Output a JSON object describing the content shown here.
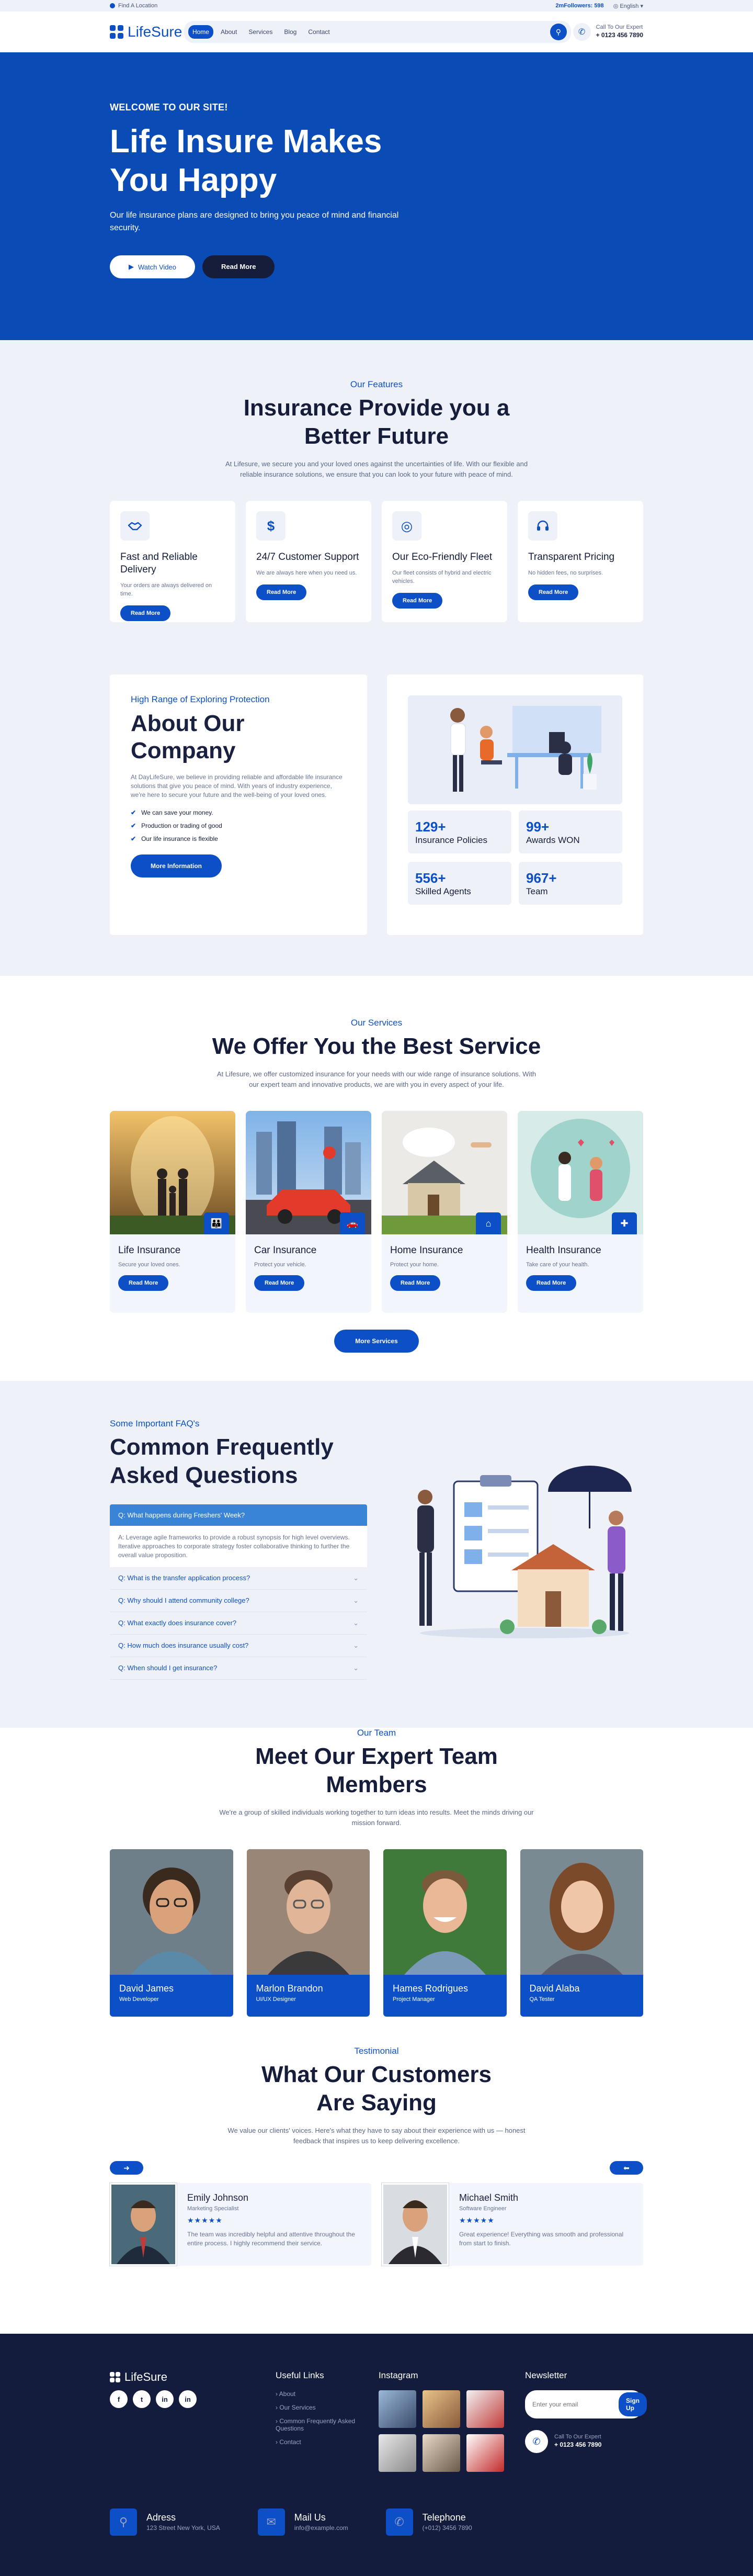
{
  "topbar": {
    "location": "Find A Location",
    "followers": "2mFollowers: 598",
    "language": "English"
  },
  "header": {
    "brand": "LifeSure",
    "nav": [
      "Home",
      "About",
      "Services",
      "Blog",
      "Contact"
    ],
    "call_label": "Call To Our Expert",
    "call_number": "+ 0123 456 7890"
  },
  "hero": {
    "welcome": "WELCOME TO OUR SITE!",
    "title": "Life Insure Makes You Happy",
    "text": "Our life insurance plans are designed to bring you peace of mind and financial security.",
    "watch_label": "Watch Video",
    "read_label": "Read More"
  },
  "features": {
    "eyebrow": "Our Features",
    "title": "Insurance Provide you a Better Future",
    "desc": "At Lifesure, we secure you and your loved ones against the uncertainties of life. With our flexible and reliable insurance solutions, we ensure that you can look to your future with peace of mind.",
    "cards": [
      {
        "title": "Fast and Reliable Delivery",
        "text": "Your orders are always delivered on time.",
        "icon": "handshake-icon",
        "btn": "Read More"
      },
      {
        "title": "24/7 Customer Support",
        "text": "We are always here when you need us.",
        "icon": "dollar-icon",
        "btn": "Read More"
      },
      {
        "title": "Our Eco-Friendly Fleet",
        "text": "Our fleet consists of hybrid and electric vehicles.",
        "icon": "target-icon",
        "btn": "Read More"
      },
      {
        "title": "Transparent Pricing",
        "text": "No hidden fees, no surprises.",
        "icon": "headset-icon",
        "btn": "Read More"
      }
    ]
  },
  "about": {
    "eyebrow": "High Range of Exploring Protection",
    "title": "About Our Company",
    "text": "At DayLifeSure, we believe in providing reliable and affordable life insurance solutions that give you peace of mind. With years of industry experience, we're here to secure your future and the well-being of your loved ones.",
    "checks": [
      "We can save your money.",
      "Production or trading of good",
      "Our life insurance is flexible"
    ],
    "btn": "More Information",
    "stats": [
      {
        "value": "129+",
        "label": "Insurance Policies"
      },
      {
        "value": "99+",
        "label": "Awards WON"
      },
      {
        "value": "556+",
        "label": "Skilled Agents"
      },
      {
        "value": "967+",
        "label": "Team"
      }
    ]
  },
  "services": {
    "eyebrow": "Our Services",
    "title": "We Offer You the Best Service",
    "desc": "At Lifesure, we offer customized insurance for your needs with our wide range of insurance solutions. With our expert team and innovative products, we are with you in every aspect of your life.",
    "cards": [
      {
        "title": "Life Insurance",
        "text": "Secure your loved ones.",
        "btn": "Read More"
      },
      {
        "title": "Car Insurance",
        "text": "Protect your vehicle.",
        "btn": "Read More"
      },
      {
        "title": "Home Insurance",
        "text": "Protect your home.",
        "btn": "Read More"
      },
      {
        "title": "Health Insurance",
        "text": "Take care of your health.",
        "btn": "Read More"
      }
    ],
    "more_btn": "More Services"
  },
  "faq": {
    "eyebrow": "Some Important FAQ's",
    "title": "Common Frequently Asked Questions",
    "open_q": "Q: What happens during Freshers' Week?",
    "open_a": "A: Leverage agile frameworks to provide a robust synopsis for high level overviews. Iterative approaches to corporate strategy foster collaborative thinking to further the overall value proposition.",
    "items": [
      "Q: What is the transfer application process?",
      "Q: Why should I attend community college?",
      "Q: What exactly does insurance cover?",
      "Q: How much does insurance usually cost?",
      "Q: When should I get insurance?"
    ]
  },
  "team": {
    "eyebrow": "Our Team",
    "title": "Meet Our Expert Team Members",
    "desc": "We're a group of skilled individuals working together to turn ideas into results. Meet the minds driving our mission forward.",
    "members": [
      {
        "name": "David James",
        "role": "Web Developer"
      },
      {
        "name": "Marlon Brandon",
        "role": "UI/UX Designer"
      },
      {
        "name": "Hames Rodrigues",
        "role": "Project Manager"
      },
      {
        "name": "David Alaba",
        "role": "QA Tester"
      }
    ]
  },
  "testimonial": {
    "eyebrow": "Testimonial",
    "title": "What Our Customers Are Saying",
    "desc": "We value our clients' voices. Here's what they have to say about their experience with us — honest feedback that inspires us to keep delivering excellence.",
    "items": [
      {
        "name": "Emily Johnson",
        "role": "Marketing Specialist",
        "stars": "★★★★★",
        "text": "The team was incredibly helpful and attentive throughout the entire process. I highly recommend their service."
      },
      {
        "name": "Michael Smith",
        "role": "Software Engineer",
        "stars": "★★★★★",
        "text": "Great experience! Everything was smooth and professional from start to finish."
      }
    ]
  },
  "footer": {
    "brand": "LifeSure",
    "socials": [
      "f",
      "t",
      "in",
      "in"
    ],
    "links_title": "Useful Links",
    "links": [
      "About",
      "Our Services",
      "Common Frequently Asked Questions",
      "Contact"
    ],
    "insta_title": "Instagram",
    "news_title": "Newsletter",
    "news_placeholder": "Enter your email",
    "news_btn": "Sign Up",
    "call_label": "Call To Our Expert",
    "call_number": "+ 0123 456 7890",
    "contacts": [
      {
        "title": "Adress",
        "text": "123 Street New York, USA"
      },
      {
        "title": "Mail Us",
        "text": "info@example.com"
      },
      {
        "title": "Telephone",
        "text": "(+012) 3456 7890"
      }
    ]
  },
  "colors": {
    "primary": "#0d4fc6",
    "hero_bg": "#0a4bb5",
    "dark": "#141c3d",
    "light_bg": "#eef2f8"
  }
}
